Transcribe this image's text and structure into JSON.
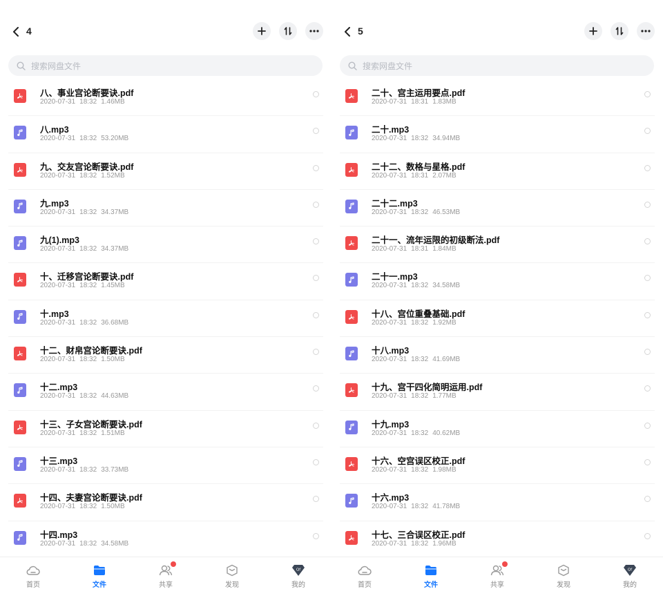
{
  "common": {
    "search_placeholder": "搜索网盘文件",
    "tabs": [
      "首页",
      "文件",
      "共享",
      "发现",
      "我的"
    ],
    "active_tab": 1,
    "colors": {
      "accent": "#1677ff",
      "pdf": "#f14b4b",
      "mp3": "#7b7be8",
      "badge": "#f14b4b"
    }
  },
  "panels": [
    {
      "title": "4",
      "files": [
        {
          "name": "八、事业宫论断要诀.pdf",
          "type": "pdf",
          "date": "2020-07-31",
          "time": "18:32",
          "size": "1.46MB"
        },
        {
          "name": "八.mp3",
          "type": "mp3",
          "date": "2020-07-31",
          "time": "18:32",
          "size": "53.20MB"
        },
        {
          "name": "九、交友宫论断要诀.pdf",
          "type": "pdf",
          "date": "2020-07-31",
          "time": "18:32",
          "size": "1.52MB"
        },
        {
          "name": "九.mp3",
          "type": "mp3",
          "date": "2020-07-31",
          "time": "18:32",
          "size": "34.37MB"
        },
        {
          "name": "九(1).mp3",
          "type": "mp3",
          "date": "2020-07-31",
          "time": "18:32",
          "size": "34.37MB"
        },
        {
          "name": "十、迁移宫论断要诀.pdf",
          "type": "pdf",
          "date": "2020-07-31",
          "time": "18:32",
          "size": "1.45MB"
        },
        {
          "name": "十.mp3",
          "type": "mp3",
          "date": "2020-07-31",
          "time": "18:32",
          "size": "36.68MB"
        },
        {
          "name": "十二、财帛宫论断要诀.pdf",
          "type": "pdf",
          "date": "2020-07-31",
          "time": "18:32",
          "size": "1.50MB"
        },
        {
          "name": "十二.mp3",
          "type": "mp3",
          "date": "2020-07-31",
          "time": "18:32",
          "size": "44.63MB"
        },
        {
          "name": "十三、子女宫论断要诀.pdf",
          "type": "pdf",
          "date": "2020-07-31",
          "time": "18:32",
          "size": "1.51MB"
        },
        {
          "name": "十三.mp3",
          "type": "mp3",
          "date": "2020-07-31",
          "time": "18:32",
          "size": "33.73MB"
        },
        {
          "name": "十四、夫妻宫论断要诀.pdf",
          "type": "pdf",
          "date": "2020-07-31",
          "time": "18:32",
          "size": "1.50MB"
        },
        {
          "name": "十四.mp3",
          "type": "mp3",
          "date": "2020-07-31",
          "time": "18:32",
          "size": "34.58MB"
        }
      ]
    },
    {
      "title": "5",
      "files": [
        {
          "name": "二十、宫主运用要点.pdf",
          "type": "pdf",
          "date": "2020-07-31",
          "time": "18:31",
          "size": "1.83MB"
        },
        {
          "name": "二十.mp3",
          "type": "mp3",
          "date": "2020-07-31",
          "time": "18:32",
          "size": "34.94MB"
        },
        {
          "name": "二十二、数格与星格.pdf",
          "type": "pdf",
          "date": "2020-07-31",
          "time": "18:31",
          "size": "2.07MB"
        },
        {
          "name": "二十二.mp3",
          "type": "mp3",
          "date": "2020-07-31",
          "time": "18:32",
          "size": "46.53MB"
        },
        {
          "name": "二十一、流年运限的初级断法.pdf",
          "type": "pdf",
          "date": "2020-07-31",
          "time": "18:31",
          "size": "1.84MB"
        },
        {
          "name": "二十一.mp3",
          "type": "mp3",
          "date": "2020-07-31",
          "time": "18:32",
          "size": "34.58MB"
        },
        {
          "name": "十八、宫位重叠基础.pdf",
          "type": "pdf",
          "date": "2020-07-31",
          "time": "18:32",
          "size": "1.92MB"
        },
        {
          "name": "十八.mp3",
          "type": "mp3",
          "date": "2020-07-31",
          "time": "18:32",
          "size": "41.69MB"
        },
        {
          "name": "十九、宫干四化简明运用.pdf",
          "type": "pdf",
          "date": "2020-07-31",
          "time": "18:32",
          "size": "1.77MB"
        },
        {
          "name": "十九.mp3",
          "type": "mp3",
          "date": "2020-07-31",
          "time": "18:32",
          "size": "40.62MB"
        },
        {
          "name": "十六、空宫误区校正.pdf",
          "type": "pdf",
          "date": "2020-07-31",
          "time": "18:32",
          "size": "1.98MB"
        },
        {
          "name": "十六.mp3",
          "type": "mp3",
          "date": "2020-07-31",
          "time": "18:32",
          "size": "41.78MB"
        },
        {
          "name": "十七、三合误区校正.pdf",
          "type": "pdf",
          "date": "2020-07-31",
          "time": "18:32",
          "size": "1.96MB"
        }
      ]
    }
  ]
}
